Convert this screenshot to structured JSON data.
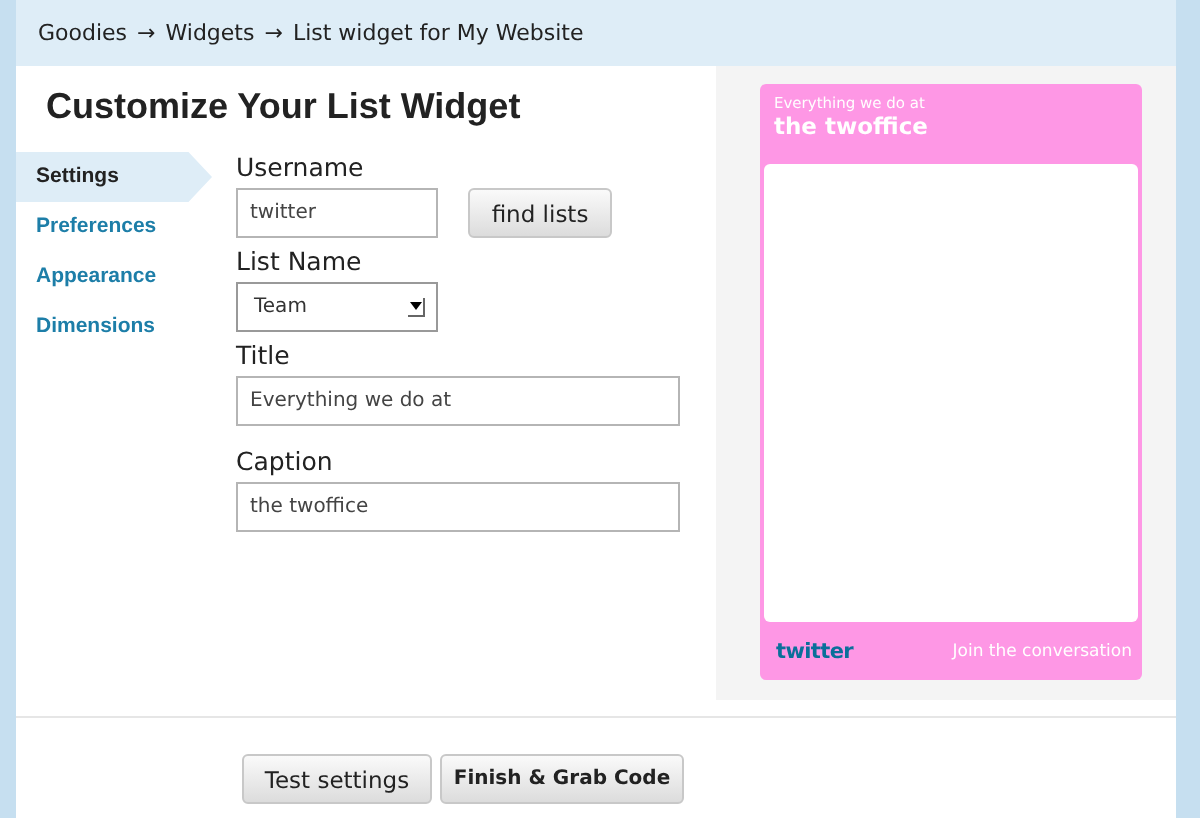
{
  "breadcrumb": {
    "items": [
      "Goodies",
      "Widgets",
      "List widget for My Website"
    ],
    "separator": "→"
  },
  "heading": "Customize Your List Widget",
  "sidebar": {
    "items": [
      {
        "label": "Settings",
        "selected": true
      },
      {
        "label": "Preferences",
        "selected": false
      },
      {
        "label": "Appearance",
        "selected": false
      },
      {
        "label": "Dimensions",
        "selected": false
      }
    ]
  },
  "form": {
    "fields": [
      {
        "kind": "text-with-button",
        "label": "Username",
        "value": "twitter",
        "button": "find lists"
      },
      {
        "kind": "select",
        "label": "List Name",
        "value": "Team"
      },
      {
        "kind": "text",
        "label": "Title",
        "value": "Everything we do at"
      },
      {
        "kind": "text",
        "label": "Caption",
        "value": "the twoffice"
      }
    ]
  },
  "preview": {
    "title": "Everything we do at",
    "caption": "the twoffice",
    "logo": "twitter",
    "footer_link": "Join the conversation"
  },
  "buttons": [
    "Test settings",
    "Finish & Grab Code"
  ]
}
